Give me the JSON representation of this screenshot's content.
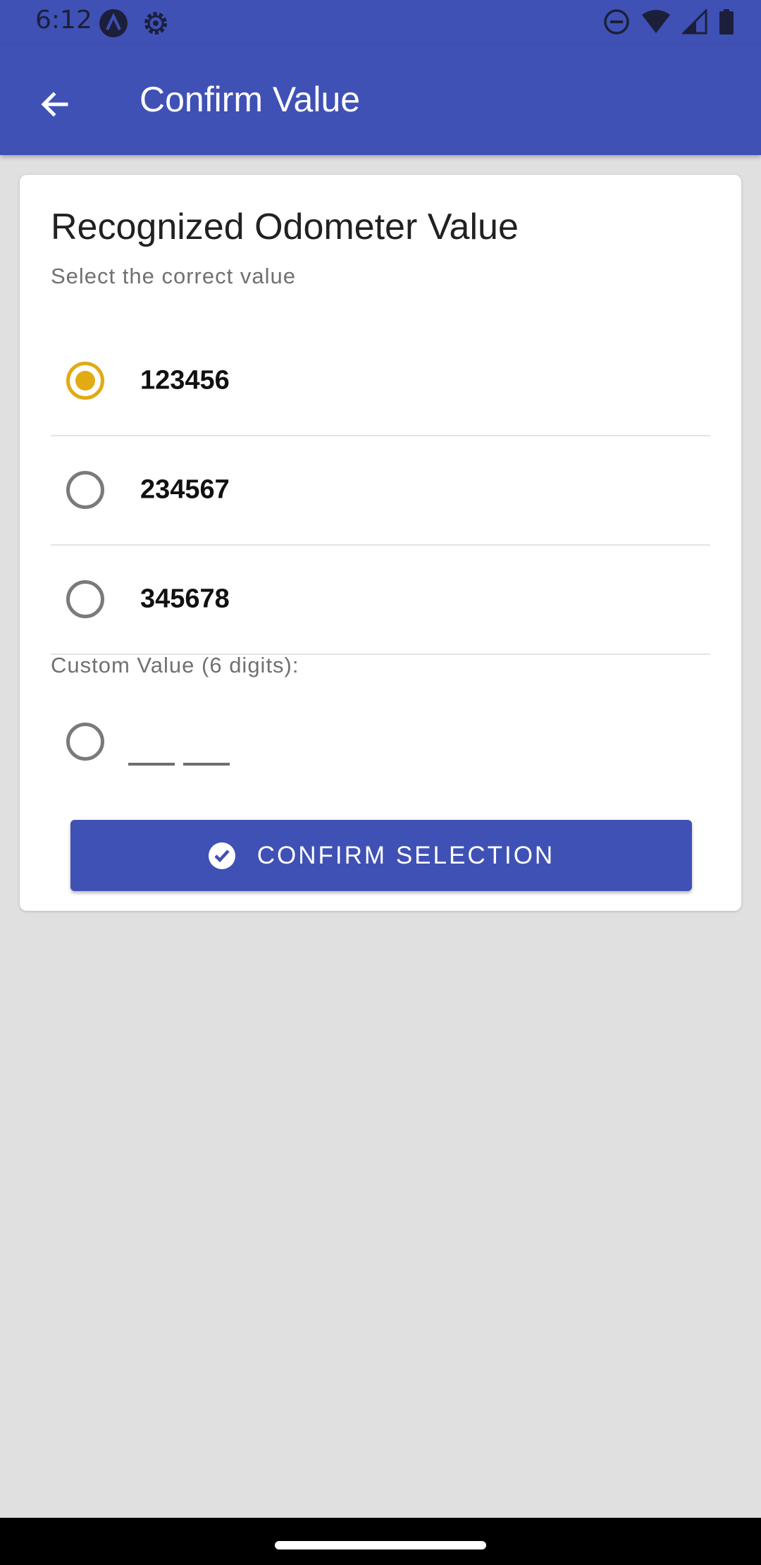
{
  "status_bar": {
    "time": "6:12",
    "left_icons": [
      "app-notification-icon",
      "settings-gear-icon"
    ],
    "right_icons": [
      "do-not-disturb-icon",
      "wifi-icon",
      "cell-signal-icon",
      "battery-icon"
    ]
  },
  "app_bar": {
    "title": "Confirm Value",
    "back_icon": "arrow-back-icon",
    "color": "#3f51b5"
  },
  "card": {
    "title": "Recognized Odometer Value",
    "subtitle": "Select the correct value",
    "options": [
      {
        "value": "123456",
        "selected": true
      },
      {
        "value": "234567",
        "selected": false
      },
      {
        "value": "345678",
        "selected": false
      }
    ],
    "custom": {
      "label": "Custom Value (6 digits):",
      "selected": false,
      "value": ""
    },
    "confirm_button": {
      "label": "CONFIRM SELECTION",
      "icon": "check-circle-icon"
    }
  },
  "colors": {
    "primary": "#3f51b5",
    "radio_selected": "#e2ab13",
    "background": "#e0e0e0"
  }
}
